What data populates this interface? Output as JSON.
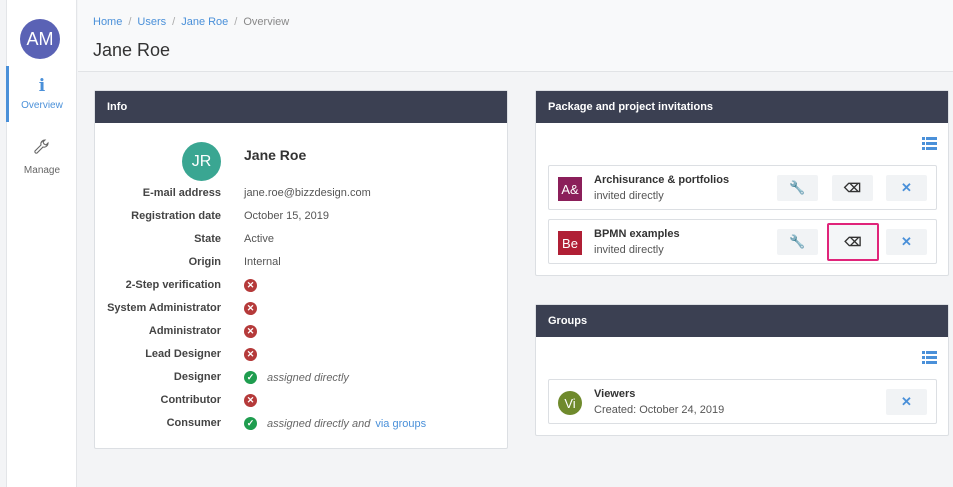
{
  "sidebar": {
    "avatar_initials": "AM",
    "avatar_color": "#5a62b5",
    "items": [
      {
        "label": "Overview",
        "icon": "info-icon",
        "glyph": "i"
      },
      {
        "label": "Manage",
        "icon": "wrench-icon",
        "glyph": "🔧"
      }
    ]
  },
  "breadcrumb": [
    "Home",
    "Users",
    "Jane Roe",
    "Overview"
  ],
  "page_title": "Jane Roe",
  "info": {
    "heading": "Info",
    "avatar_initials": "JR",
    "avatar_color": "#3aa692",
    "name": "Jane Roe",
    "rows": [
      {
        "label": "E-mail address",
        "value": "jane.roe@bizzdesign.com"
      },
      {
        "label": "Registration date",
        "value": "October 15, 2019"
      },
      {
        "label": "State",
        "value": "Active"
      },
      {
        "label": "Origin",
        "value": "Internal"
      },
      {
        "label": "2-Step verification",
        "status": "no"
      },
      {
        "label": "System Administrator",
        "status": "no"
      },
      {
        "label": "Administrator",
        "status": "no"
      },
      {
        "label": "Lead Designer",
        "status": "no"
      },
      {
        "label": "Designer",
        "status": "yes",
        "note": "assigned directly"
      },
      {
        "label": "Contributor",
        "status": "no"
      },
      {
        "label": "Consumer",
        "status": "yes",
        "note": "assigned directly and",
        "link": "via groups"
      }
    ]
  },
  "packages": {
    "heading": "Package and project invitations",
    "items": [
      {
        "initials": "A&",
        "color": "#8b1f5a",
        "title": "Archisurance & portfolios",
        "subtitle": "invited directly"
      },
      {
        "initials": "Be",
        "color": "#b01f35",
        "title": "BPMN examples",
        "subtitle": "invited directly"
      }
    ]
  },
  "groups": {
    "heading": "Groups",
    "items": [
      {
        "initials": "Vi",
        "color": "#6f8a2c",
        "title": "Viewers",
        "subtitle": "Created: October 24, 2019"
      }
    ]
  },
  "colors": {
    "accent": "#4a90d9",
    "header_dark": "#3b4052",
    "error": "#b53a3a",
    "success": "#1f9d4f",
    "highlight": "#e0247a"
  }
}
